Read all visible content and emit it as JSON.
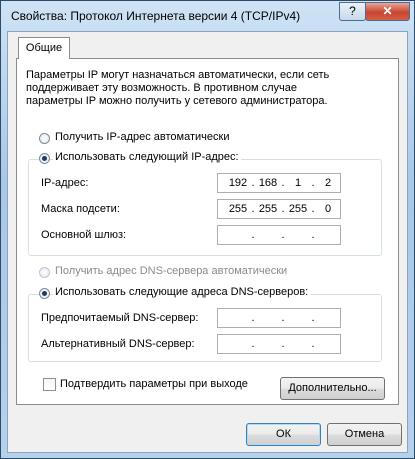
{
  "window": {
    "title": "Свойства: Протокол Интернета версии 4 (TCP/IPv4)",
    "help_label": "?",
    "close_label": "✕"
  },
  "tabs": [
    {
      "label": "Общие"
    }
  ],
  "description": "Параметры IP могут назначаться автоматически, если сеть поддерживает эту возможность. В противном случае параметры IP можно получить у сетевого администратора.",
  "ip_auto_label": "Получить IP-адрес автоматически",
  "ip_manual_label": "Использовать следующий IP-адрес:",
  "ip_fields": {
    "address": {
      "label": "IP-адрес:",
      "octets": [
        "192",
        "168",
        "1",
        "2"
      ]
    },
    "mask": {
      "label": "Маска подсети:",
      "octets": [
        "255",
        "255",
        "255",
        "0"
      ]
    },
    "gateway": {
      "label": "Основной шлюз:",
      "octets": [
        "",
        "",
        "",
        ""
      ]
    }
  },
  "dns_auto_label": "Получить адрес DNS-сервера автоматически",
  "dns_manual_label": "Использовать следующие адреса DNS-серверов:",
  "dns_fields": {
    "preferred": {
      "label": "Предпочитаемый DNS-сервер:",
      "octets": [
        "",
        "",
        "",
        ""
      ]
    },
    "alternate": {
      "label": "Альтернативный DNS-сервер:",
      "octets": [
        "",
        "",
        "",
        ""
      ]
    }
  },
  "confirm_label": "Подтвердить параметры при выходе",
  "advanced_label": "Дополнительно...",
  "ok_label": "ОК",
  "cancel_label": "Отмена",
  "separator": ".",
  "state": {
    "ip_mode": "manual",
    "dns_mode": "manual",
    "confirm_checked": false
  }
}
